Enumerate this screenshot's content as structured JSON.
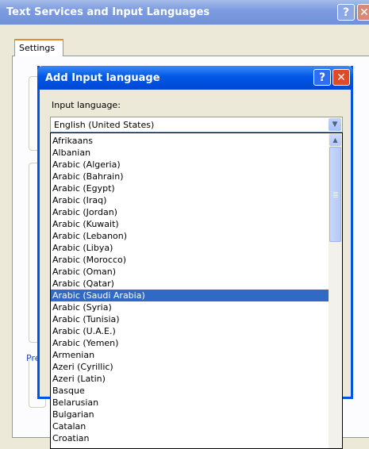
{
  "outer_window": {
    "title": "Text Services and Input Languages",
    "help_glyph": "?",
    "close_glyph": "✕",
    "tab_label": "Settings",
    "preferences_fragment": "Pre"
  },
  "dialog": {
    "title": "Add Input language",
    "help_glyph": "?",
    "close_glyph": "✕",
    "input_language_label": "Input language:",
    "selected_value": "English (United States)",
    "dropdown_arrow": "▼",
    "scroll_up_arrow": "▲"
  },
  "languages": [
    "Afrikaans",
    "Albanian",
    "Arabic (Algeria)",
    "Arabic (Bahrain)",
    "Arabic (Egypt)",
    "Arabic (Iraq)",
    "Arabic (Jordan)",
    "Arabic (Kuwait)",
    "Arabic (Lebanon)",
    "Arabic (Libya)",
    "Arabic (Morocco)",
    "Arabic (Oman)",
    "Arabic (Qatar)",
    "Arabic (Saudi Arabia)",
    "Arabic (Syria)",
    "Arabic (Tunisia)",
    "Arabic (U.A.E.)",
    "Arabic (Yemen)",
    "Armenian",
    "Azeri (Cyrillic)",
    "Azeri (Latin)",
    "Basque",
    "Belarusian",
    "Bulgarian",
    "Catalan",
    "Croatian"
  ],
  "highlighted_language": "Arabic (Saudi Arabia)",
  "colors": {
    "selection": "#316AC5",
    "dialog_title": "#0058E6",
    "outer_title_inactive": "#7D9CE0",
    "window_face": "#ECE9D8"
  }
}
